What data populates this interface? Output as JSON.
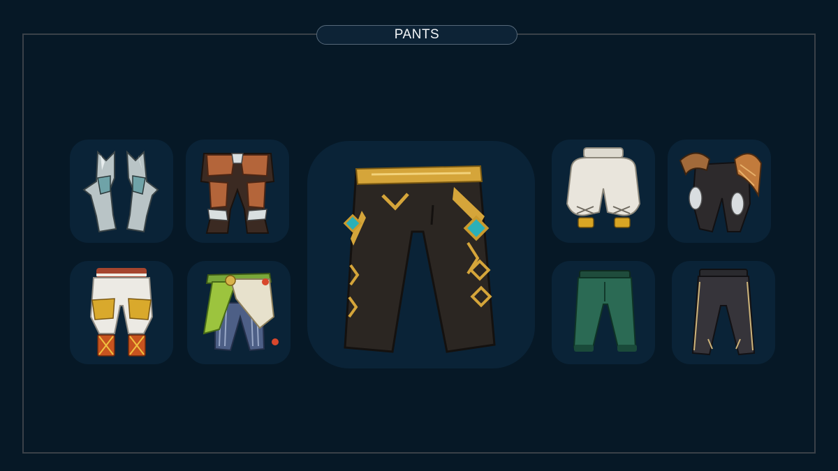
{
  "header": {
    "title": "PANTS"
  },
  "items": [
    {
      "name": "silver-plate-leggings-icon",
      "selected": false
    },
    {
      "name": "bronze-armor-pants-icon",
      "selected": false
    },
    {
      "name": "white-pants-gold-plates-icon",
      "selected": false
    },
    {
      "name": "feathered-tribal-pants-icon",
      "selected": false
    },
    {
      "name": "black-gold-trim-pants-icon",
      "selected": true
    },
    {
      "name": "white-puffy-pants-icon",
      "selected": false
    },
    {
      "name": "winged-dark-armor-pants-icon",
      "selected": false
    },
    {
      "name": "green-pants-icon",
      "selected": false
    },
    {
      "name": "dark-pants-icon",
      "selected": false
    }
  ],
  "colors": {
    "background": "#061826",
    "panel": "#0a2337",
    "frame": "#3a4148",
    "gold": "#c99a2e",
    "teal-gem": "#2bb0b8"
  }
}
